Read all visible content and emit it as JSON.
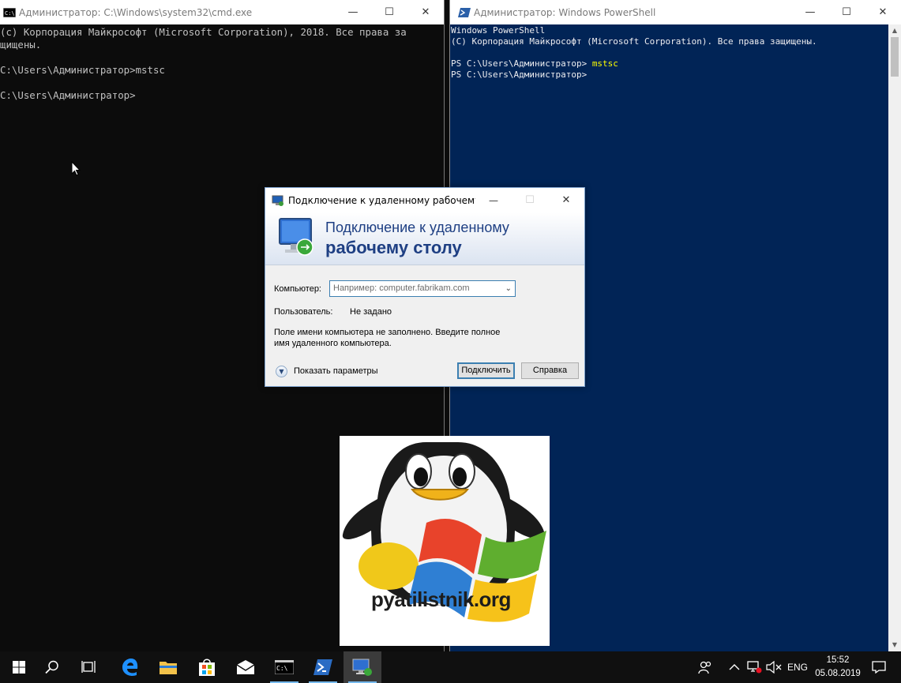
{
  "cmd": {
    "title": "Администратор: C:\\Windows\\system32\\cmd.exe",
    "lines": [
      "(c) Корпорация Майкрософт (Microsoft Corporation), 2018. Все права за",
      "щищены.",
      "",
      "C:\\Users\\Администратор>mstsc",
      "",
      "C:\\Users\\Администратор>"
    ]
  },
  "powershell": {
    "title": "Администратор: Windows PowerShell",
    "line1": "Windows PowerShell",
    "line2": "(C) Корпорация Майкрософт (Microsoft Corporation). Все права защищены.",
    "line3_prompt": "PS C:\\Users\\Администратор> ",
    "line3_cmd": "mstsc",
    "line4": "PS C:\\Users\\Администратор>"
  },
  "rdp": {
    "title": "Подключение к удаленному рабочему с...",
    "banner_line1": "Подключение к удаленному",
    "banner_line2": "рабочему столу",
    "computer_label": "Компьютер:",
    "computer_placeholder": "Например: computer.fabrikam.com",
    "user_label": "Пользователь:",
    "user_value": "Не задано",
    "message_line1": "Поле имени компьютера не заполнено. Введите полное",
    "message_line2": "имя удаленного компьютера.",
    "show_options": "Показать параметры",
    "connect_button": "Подключить",
    "help_button": "Справка"
  },
  "logo": {
    "text": "pyatilistnik.org"
  },
  "taskbar": {
    "items": [
      "start-icon",
      "search-icon",
      "task-view-icon",
      "edge-icon",
      "file-explorer-icon",
      "store-icon",
      "mail-icon",
      "cmd-icon",
      "powershell-icon",
      "remote-desktop-icon"
    ],
    "language": "ENG",
    "time": "15:52",
    "date": "05.08.2019"
  }
}
